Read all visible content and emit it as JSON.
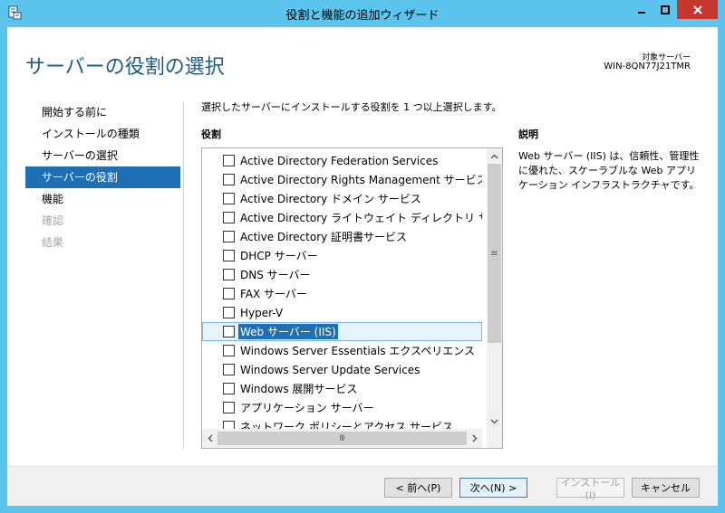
{
  "window": {
    "title": "役割と機能の追加ウィザード",
    "controls": {
      "minimize": "–",
      "maximize": "□",
      "close": "✕"
    },
    "close_color": "#c7372e",
    "frame_color": "#5bc5ee"
  },
  "header": {
    "page_title": "サーバーの役割の選択",
    "target_label": "対象サーバー",
    "target_name": "WIN-8QN77J21TMR"
  },
  "nav": {
    "items": [
      {
        "label": "開始する前に",
        "state": "normal"
      },
      {
        "label": "インストールの種類",
        "state": "normal"
      },
      {
        "label": "サーバーの選択",
        "state": "normal"
      },
      {
        "label": "サーバーの役割",
        "state": "active"
      },
      {
        "label": "機能",
        "state": "normal"
      },
      {
        "label": "確認",
        "state": "disabled"
      },
      {
        "label": "結果",
        "state": "disabled"
      }
    ]
  },
  "main": {
    "instruction": "選択したサーバーにインストールする役割を 1 つ以上選択します。",
    "roles_header": "役割",
    "roles": [
      {
        "label": "Active Directory Federation Services",
        "checked": false
      },
      {
        "label": "Active Directory Rights Management サービス",
        "checked": false
      },
      {
        "label": "Active Directory ドメイン サービス",
        "checked": false
      },
      {
        "label": "Active Directory ライトウェイト ディレクトリ サービス",
        "checked": false
      },
      {
        "label": "Active Directory 証明書サービス",
        "checked": false
      },
      {
        "label": "DHCP サーバー",
        "checked": false
      },
      {
        "label": "DNS サーバー",
        "checked": false
      },
      {
        "label": "FAX サーバー",
        "checked": false
      },
      {
        "label": "Hyper-V",
        "checked": false
      },
      {
        "label": "Web サーバー (IIS)",
        "checked": false,
        "selected": true
      },
      {
        "label": "Windows Server Essentials エクスペリエンス",
        "checked": false
      },
      {
        "label": "Windows Server Update Services",
        "checked": false
      },
      {
        "label": "Windows 展開サービス",
        "checked": false
      },
      {
        "label": "アプリケーション サーバー",
        "checked": false
      },
      {
        "label": "ネットワーク ポリシーとアクセス サービス",
        "checked": false
      }
    ],
    "description_header": "説明",
    "description": "Web サーバー (IIS) は、信頼性、管理性に優れた、スケーラブルな Web アプリケーション インフラストラクチャです。"
  },
  "scrollbars": {
    "v_grip": "≡",
    "h_grip": "Ⅲ"
  },
  "footer": {
    "prev": "< 前へ(P)",
    "next": "次へ(N) >",
    "install": "インストール(I)",
    "cancel": "キャンセル"
  },
  "colors": {
    "accent": "#1e6fb3",
    "title_text": "#1d5a86"
  }
}
